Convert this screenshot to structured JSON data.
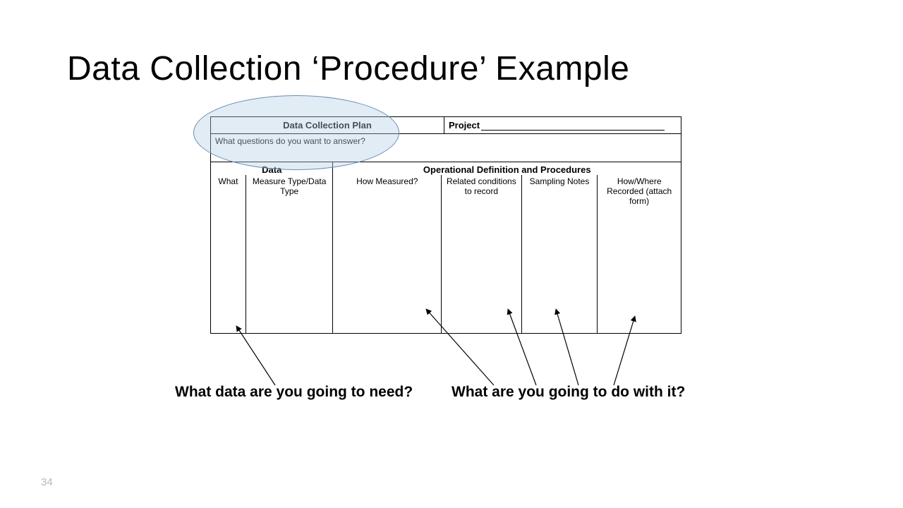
{
  "title": "Data Collection ‘Procedure’ Example",
  "table": {
    "plan_label": "Data Collection Plan",
    "project_label": "Project",
    "questions_prompt": "What questions do you want to answer?",
    "group_data": "Data",
    "group_op": "Operational Definition and Procedures",
    "cols": {
      "what": "What",
      "measure": "Measure Type/Data Type",
      "how": "How Measured?",
      "related": "Related conditions to record",
      "sampling": "Sampling Notes",
      "recorded": "How/Where Recorded (attach form)"
    }
  },
  "annotations": {
    "left": "What data are you going to need?",
    "right": "What are you going to do with it?"
  },
  "page_number": "34"
}
